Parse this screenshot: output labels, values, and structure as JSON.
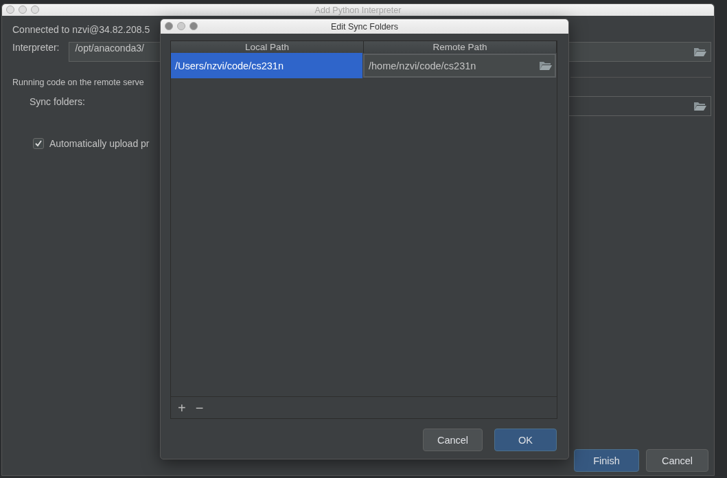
{
  "window": {
    "title": "Add Python Interpreter",
    "connected": "Connected to nzvi@34.82.208.5",
    "interpreter": {
      "label": "Interpreter:",
      "value": "/opt/anaconda3/"
    },
    "section": "Running code on the remote serve",
    "sync_folders": {
      "label": "Sync folders:"
    },
    "auto_upload": {
      "label": "Automatically upload pr",
      "checked": true
    },
    "buttons": [
      {
        "label": "Finish",
        "primary": true
      },
      {
        "label": "Cancel",
        "primary": false
      }
    ]
  },
  "dialog": {
    "title": "Edit Sync Folders",
    "columns": [
      "Local Path",
      "Remote Path"
    ],
    "rows": [
      {
        "local": "/Users/nzvi/code/cs231n",
        "remote": "/home/nzvi/code/cs231n",
        "selected": true
      }
    ],
    "toolbar": [
      "+",
      "−"
    ],
    "buttons": [
      {
        "label": "Cancel",
        "primary": false
      },
      {
        "label": "OK",
        "primary": true
      }
    ]
  }
}
